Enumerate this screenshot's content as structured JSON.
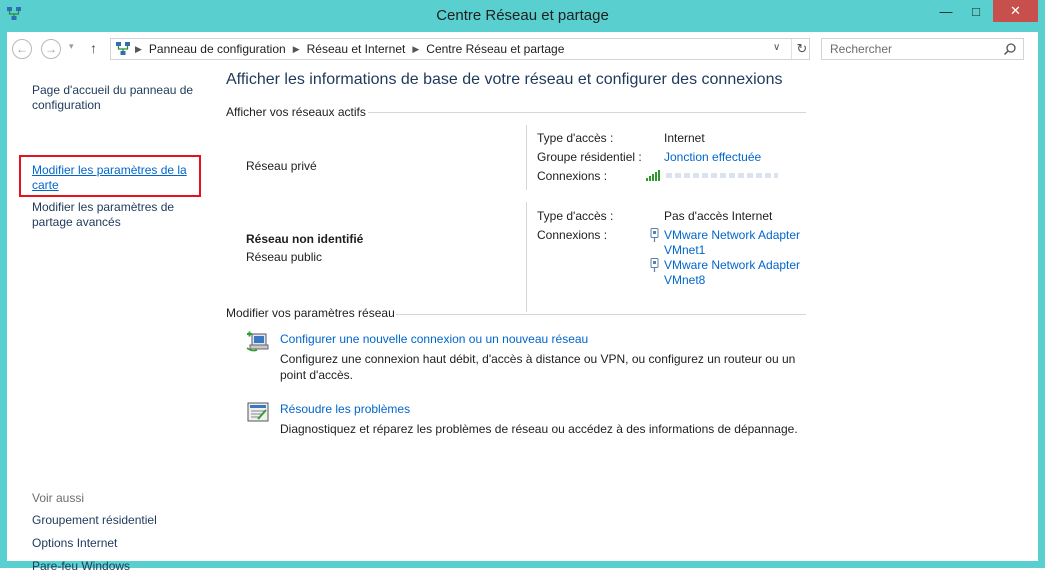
{
  "window": {
    "title": "Centre Réseau et partage",
    "minimize": "—",
    "maximize": "□",
    "close": "✕"
  },
  "nav": {
    "back": "←",
    "forward": "→",
    "recent": "▾",
    "up": "↑",
    "breadcrumbs": [
      "Panneau de configuration",
      "Réseau et Internet",
      "Centre Réseau et partage"
    ],
    "separator": "▶",
    "dropdown": "∨",
    "refresh": "↻",
    "search_placeholder": "Rechercher"
  },
  "sidebar": {
    "home": "Page d'accueil du panneau de configuration",
    "change_adapter": "Modifier les paramètres de la carte",
    "advanced_sharing": "Modifier les paramètres de partage avancés",
    "see_also": "Voir aussi",
    "see_also_items": [
      "Groupement résidentiel",
      "Options Internet",
      "Pare-feu Windows"
    ]
  },
  "main": {
    "title": "Afficher les informations de base de votre réseau et configurer des connexions",
    "active_networks_header": "Afficher vos réseaux actifs",
    "network1": {
      "name": "Réseau privé",
      "access_type_label": "Type d'accès :",
      "access_type_value": "Internet",
      "homegroup_label": "Groupe résidentiel :",
      "homegroup_value": "Jonction effectuée",
      "connections_label": "Connexions :"
    },
    "network2": {
      "name": "Réseau non identifié",
      "type": "Réseau public",
      "access_type_label": "Type d'accès :",
      "access_type_value": "Pas d'accès Internet",
      "connections_label": "Connexions :",
      "adapter1_line1": "VMware Network Adapter",
      "adapter1_line2": "VMnet1",
      "adapter2_line1": "VMware Network Adapter",
      "adapter2_line2": "VMnet8"
    },
    "change_settings_header": "Modifier vos paramètres réseau",
    "tasks": [
      {
        "title": "Configurer une nouvelle connexion ou un nouveau réseau",
        "desc_line1": "Configurez une connexion haut débit, d'accès à distance ou VPN, ou configurez un routeur ou un",
        "desc_line2": "point d'accès."
      },
      {
        "title": "Résoudre les problèmes",
        "desc_line1": "Diagnostiquez et réparez les problèmes de réseau ou accédez à des informations de dépannage."
      }
    ]
  },
  "colors": {
    "frame": "#59cfcf",
    "link": "#0066cc",
    "heading": "#1e395b",
    "highlight_box": "#e8101a",
    "close_button": "#c7504c"
  }
}
